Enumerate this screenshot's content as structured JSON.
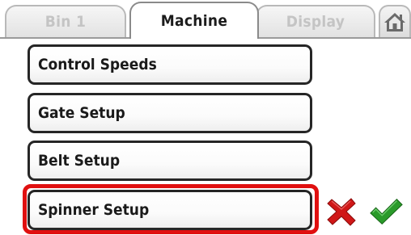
{
  "tabs": [
    {
      "label": "Bin 1",
      "active": false
    },
    {
      "label": "Machine",
      "active": true
    },
    {
      "label": "Display",
      "active": false
    }
  ],
  "home_tab": {
    "icon": "home-icon"
  },
  "menu": {
    "items": [
      {
        "label": "Control Speeds"
      },
      {
        "label": "Gate Setup"
      },
      {
        "label": "Belt Setup"
      },
      {
        "label": "Spinner Setup"
      }
    ],
    "selected_index": 3
  },
  "actions": {
    "cancel_icon": "cancel-x-icon",
    "confirm_icon": "checkmark-icon"
  },
  "colors": {
    "highlight": "#e01010",
    "cancel": "#d01818",
    "confirm": "#2a9a2a"
  }
}
